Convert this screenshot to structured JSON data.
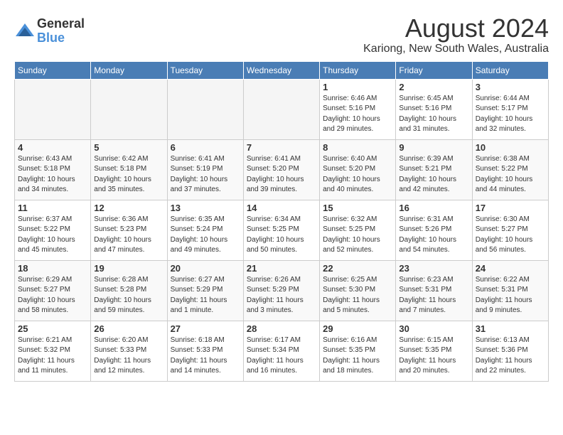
{
  "header": {
    "logo_general": "General",
    "logo_blue": "Blue",
    "month_year": "August 2024",
    "location": "Kariong, New South Wales, Australia"
  },
  "calendar": {
    "days_of_week": [
      "Sunday",
      "Monday",
      "Tuesday",
      "Wednesday",
      "Thursday",
      "Friday",
      "Saturday"
    ],
    "weeks": [
      [
        {
          "day": "",
          "empty": true
        },
        {
          "day": "",
          "empty": true
        },
        {
          "day": "",
          "empty": true
        },
        {
          "day": "",
          "empty": true
        },
        {
          "day": "1",
          "sunrise": "6:46 AM",
          "sunset": "5:16 PM",
          "daylight": "10 hours and 29 minutes."
        },
        {
          "day": "2",
          "sunrise": "6:45 AM",
          "sunset": "5:16 PM",
          "daylight": "10 hours and 31 minutes."
        },
        {
          "day": "3",
          "sunrise": "6:44 AM",
          "sunset": "5:17 PM",
          "daylight": "10 hours and 32 minutes."
        }
      ],
      [
        {
          "day": "4",
          "sunrise": "6:43 AM",
          "sunset": "5:18 PM",
          "daylight": "10 hours and 34 minutes."
        },
        {
          "day": "5",
          "sunrise": "6:42 AM",
          "sunset": "5:18 PM",
          "daylight": "10 hours and 35 minutes."
        },
        {
          "day": "6",
          "sunrise": "6:41 AM",
          "sunset": "5:19 PM",
          "daylight": "10 hours and 37 minutes."
        },
        {
          "day": "7",
          "sunrise": "6:41 AM",
          "sunset": "5:20 PM",
          "daylight": "10 hours and 39 minutes."
        },
        {
          "day": "8",
          "sunrise": "6:40 AM",
          "sunset": "5:20 PM",
          "daylight": "10 hours and 40 minutes."
        },
        {
          "day": "9",
          "sunrise": "6:39 AM",
          "sunset": "5:21 PM",
          "daylight": "10 hours and 42 minutes."
        },
        {
          "day": "10",
          "sunrise": "6:38 AM",
          "sunset": "5:22 PM",
          "daylight": "10 hours and 44 minutes."
        }
      ],
      [
        {
          "day": "11",
          "sunrise": "6:37 AM",
          "sunset": "5:22 PM",
          "daylight": "10 hours and 45 minutes."
        },
        {
          "day": "12",
          "sunrise": "6:36 AM",
          "sunset": "5:23 PM",
          "daylight": "10 hours and 47 minutes."
        },
        {
          "day": "13",
          "sunrise": "6:35 AM",
          "sunset": "5:24 PM",
          "daylight": "10 hours and 49 minutes."
        },
        {
          "day": "14",
          "sunrise": "6:34 AM",
          "sunset": "5:25 PM",
          "daylight": "10 hours and 50 minutes."
        },
        {
          "day": "15",
          "sunrise": "6:32 AM",
          "sunset": "5:25 PM",
          "daylight": "10 hours and 52 minutes."
        },
        {
          "day": "16",
          "sunrise": "6:31 AM",
          "sunset": "5:26 PM",
          "daylight": "10 hours and 54 minutes."
        },
        {
          "day": "17",
          "sunrise": "6:30 AM",
          "sunset": "5:27 PM",
          "daylight": "10 hours and 56 minutes."
        }
      ],
      [
        {
          "day": "18",
          "sunrise": "6:29 AM",
          "sunset": "5:27 PM",
          "daylight": "10 hours and 58 minutes."
        },
        {
          "day": "19",
          "sunrise": "6:28 AM",
          "sunset": "5:28 PM",
          "daylight": "10 hours and 59 minutes."
        },
        {
          "day": "20",
          "sunrise": "6:27 AM",
          "sunset": "5:29 PM",
          "daylight": "11 hours and 1 minute."
        },
        {
          "day": "21",
          "sunrise": "6:26 AM",
          "sunset": "5:29 PM",
          "daylight": "11 hours and 3 minutes."
        },
        {
          "day": "22",
          "sunrise": "6:25 AM",
          "sunset": "5:30 PM",
          "daylight": "11 hours and 5 minutes."
        },
        {
          "day": "23",
          "sunrise": "6:23 AM",
          "sunset": "5:31 PM",
          "daylight": "11 hours and 7 minutes."
        },
        {
          "day": "24",
          "sunrise": "6:22 AM",
          "sunset": "5:31 PM",
          "daylight": "11 hours and 9 minutes."
        }
      ],
      [
        {
          "day": "25",
          "sunrise": "6:21 AM",
          "sunset": "5:32 PM",
          "daylight": "11 hours and 11 minutes."
        },
        {
          "day": "26",
          "sunrise": "6:20 AM",
          "sunset": "5:33 PM",
          "daylight": "11 hours and 12 minutes."
        },
        {
          "day": "27",
          "sunrise": "6:18 AM",
          "sunset": "5:33 PM",
          "daylight": "11 hours and 14 minutes."
        },
        {
          "day": "28",
          "sunrise": "6:17 AM",
          "sunset": "5:34 PM",
          "daylight": "11 hours and 16 minutes."
        },
        {
          "day": "29",
          "sunrise": "6:16 AM",
          "sunset": "5:35 PM",
          "daylight": "11 hours and 18 minutes."
        },
        {
          "day": "30",
          "sunrise": "6:15 AM",
          "sunset": "5:35 PM",
          "daylight": "11 hours and 20 minutes."
        },
        {
          "day": "31",
          "sunrise": "6:13 AM",
          "sunset": "5:36 PM",
          "daylight": "11 hours and 22 minutes."
        }
      ]
    ]
  },
  "labels": {
    "sunrise_label": "Sunrise:",
    "sunset_label": "Sunset:",
    "daylight_label": "Daylight:"
  }
}
